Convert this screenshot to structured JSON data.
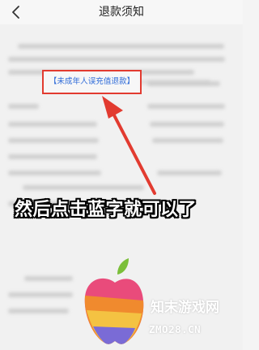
{
  "header": {
    "title": "退款须知",
    "back_icon": "chevron-left-icon"
  },
  "content": {
    "link_text": "【未成年人误充值退款】"
  },
  "annotation": {
    "caption": "然后点击蓝字就可以了",
    "arrow_color": "#e23b30"
  },
  "watermark": {
    "name": "知末游戏网",
    "domain": "ZMO28.CN"
  },
  "colors": {
    "link": "#2d6ad8",
    "highlight_border": "#e23b30"
  }
}
